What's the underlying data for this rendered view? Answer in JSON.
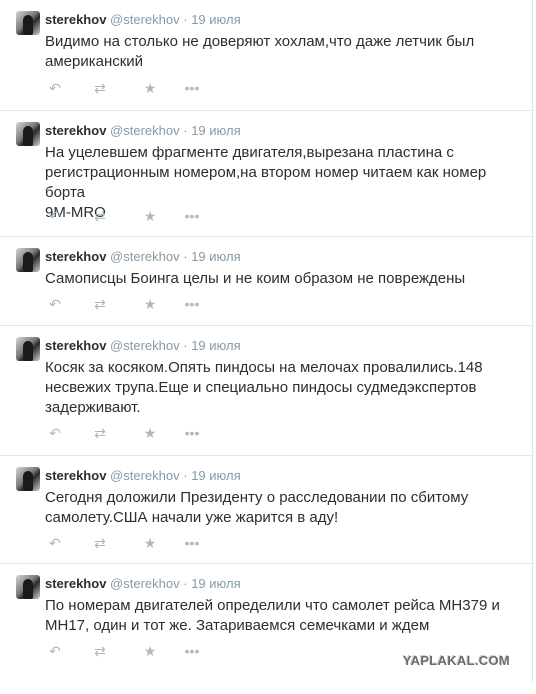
{
  "tweets": [
    {
      "name": "sterekhov",
      "handle": "@sterekhov",
      "dot": "·",
      "time": "19 июля",
      "lines": [
        "Видимо на столько не доверяют хохлам,что даже летчик был",
        "американский"
      ]
    },
    {
      "name": "sterekhov",
      "handle": "@sterekhov",
      "dot": "·",
      "time": "19 июля",
      "lines": [
        "На уцелевшем фрагменте двигателя,вырезана пластина с",
        "регистрационным номером,на втором номер читаем как номер борта",
        "9M-MRO"
      ]
    },
    {
      "name": "sterekhov",
      "handle": "@sterekhov",
      "dot": "·",
      "time": "19 июля",
      "lines": [
        "Самописцы Боинга целы и не коим образом не повреждены"
      ]
    },
    {
      "name": "sterekhov",
      "handle": "@sterekhov",
      "dot": "·",
      "time": "19 июля",
      "lines": [
        "Косяк за косяком.Опять пиндосы на мелочах провалились.148",
        "несвежих трупа.Еще и специально пиндосы судмедэкспертов",
        "задерживают."
      ]
    },
    {
      "name": "sterekhov",
      "handle": "@sterekhov",
      "dot": "·",
      "time": "19 июля",
      "lines": [
        "Сегодня доложили Президенту о расследовании по сбитому",
        "самолету.США начали уже жарится в аду!"
      ]
    },
    {
      "name": "sterekhov",
      "handle": "@sterekhov",
      "dot": "·",
      "time": "19 июля",
      "lines": [
        "По номерам двигателей определили что самолет рейса MH379 и",
        "MH17, один и тот же. Затариваемся семечками и ждем"
      ]
    }
  ],
  "icons": {
    "reply": "reply-icon",
    "retweet": "retweet-icon",
    "favorite": "star-icon",
    "more": "more-icon"
  },
  "watermark": "YAPLAKAL.COM"
}
